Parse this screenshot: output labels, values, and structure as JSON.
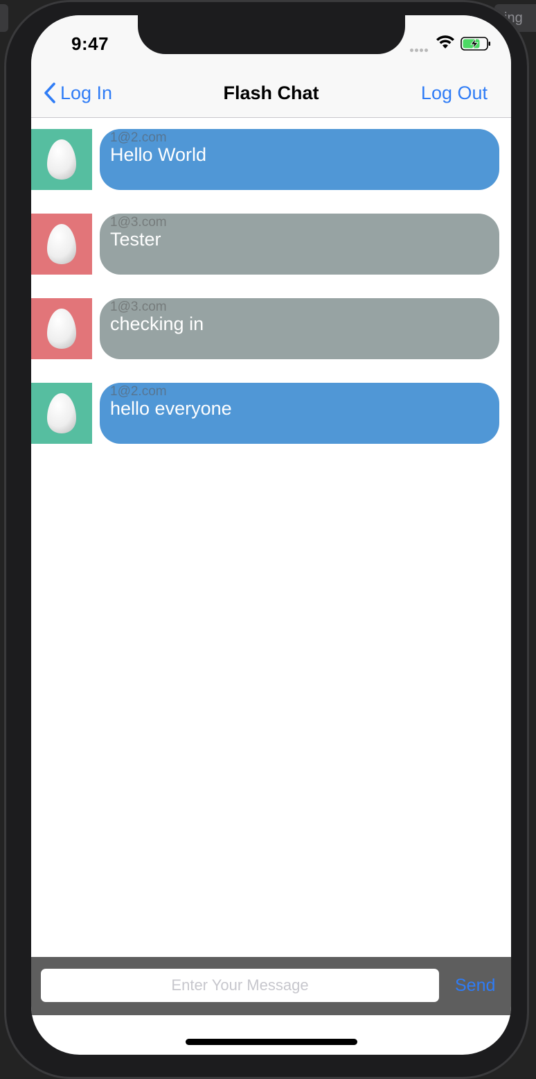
{
  "status_bar": {
    "time": "9:47"
  },
  "nav": {
    "back_label": "Log In",
    "title": "Flash Chat",
    "right_label": "Log Out"
  },
  "colors": {
    "self_bubble": "#5097d6",
    "other_bubble": "#97a3a3",
    "self_avatar": "#56bea0",
    "other_avatar": "#e27579",
    "accent": "#2f7cf6"
  },
  "messages": [
    {
      "sender": "1@2.com",
      "body": "Hello World",
      "kind": "self"
    },
    {
      "sender": "1@3.com",
      "body": "Tester",
      "kind": "other"
    },
    {
      "sender": "1@3.com",
      "body": "checking in",
      "kind": "other"
    },
    {
      "sender": "1@2.com",
      "body": "hello everyone",
      "kind": "self"
    }
  ],
  "composer": {
    "placeholder": "Enter Your Message",
    "value": "",
    "send_label": "Send"
  },
  "background": {
    "tab_label": "ing"
  }
}
